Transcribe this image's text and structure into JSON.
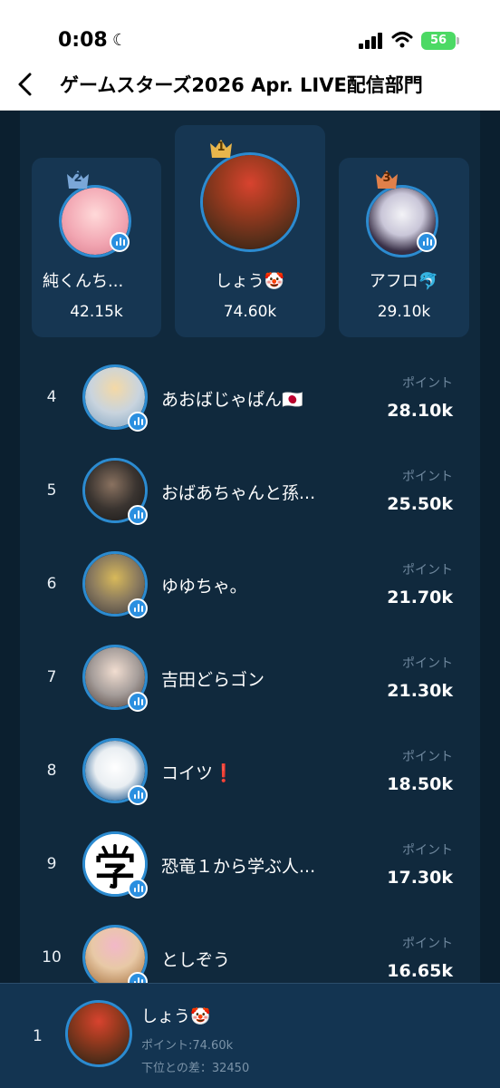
{
  "status_bar": {
    "time": "0:08",
    "battery": "56"
  },
  "nav": {
    "title": "ゲームスターズ2026 Apr. LIVE配信部門"
  },
  "podium": [
    {
      "rank": "2",
      "name": "純くんち...",
      "points": "42.15k",
      "crown_color": "#7aa7d8"
    },
    {
      "rank": "1",
      "name": "しょう🤡",
      "points": "74.60k",
      "crown_color": "#e8b64c"
    },
    {
      "rank": "3",
      "name": "アフロ🐬",
      "points": "29.10k",
      "crown_color": "#e0804a"
    }
  ],
  "ranking": {
    "point_label": "ポイント",
    "rows": [
      {
        "rank": "4",
        "name": "あおばじゃぱん🇯🇵",
        "points": "28.10k"
      },
      {
        "rank": "5",
        "name": "おばあちゃんと孫...",
        "points": "25.50k"
      },
      {
        "rank": "6",
        "name": "ゆゆちゃ。",
        "points": "21.70k"
      },
      {
        "rank": "7",
        "name": "吉田どらゴン",
        "points": "21.30k"
      },
      {
        "rank": "8",
        "name": "コイツ❗",
        "points": "18.50k"
      },
      {
        "rank": "9",
        "name": "恐竜１から学ぶ人...",
        "points": "17.30k"
      },
      {
        "rank": "10",
        "name": "としぞう",
        "points": "16.65k"
      }
    ]
  },
  "my_rank": {
    "rank": "1",
    "name": "しょう🤡",
    "points_text": "ポイント:74.60k",
    "gap_text": "下位との差：32450"
  },
  "icons": [
    "moon-icon",
    "signal-icon",
    "wifi-icon",
    "battery-icon",
    "back-icon",
    "crown-icon",
    "live-badge-icon"
  ],
  "colors": {
    "background": "#0b1f2f",
    "panel": "#10293d",
    "card": "#163652",
    "accent": "#2a8fe0"
  }
}
